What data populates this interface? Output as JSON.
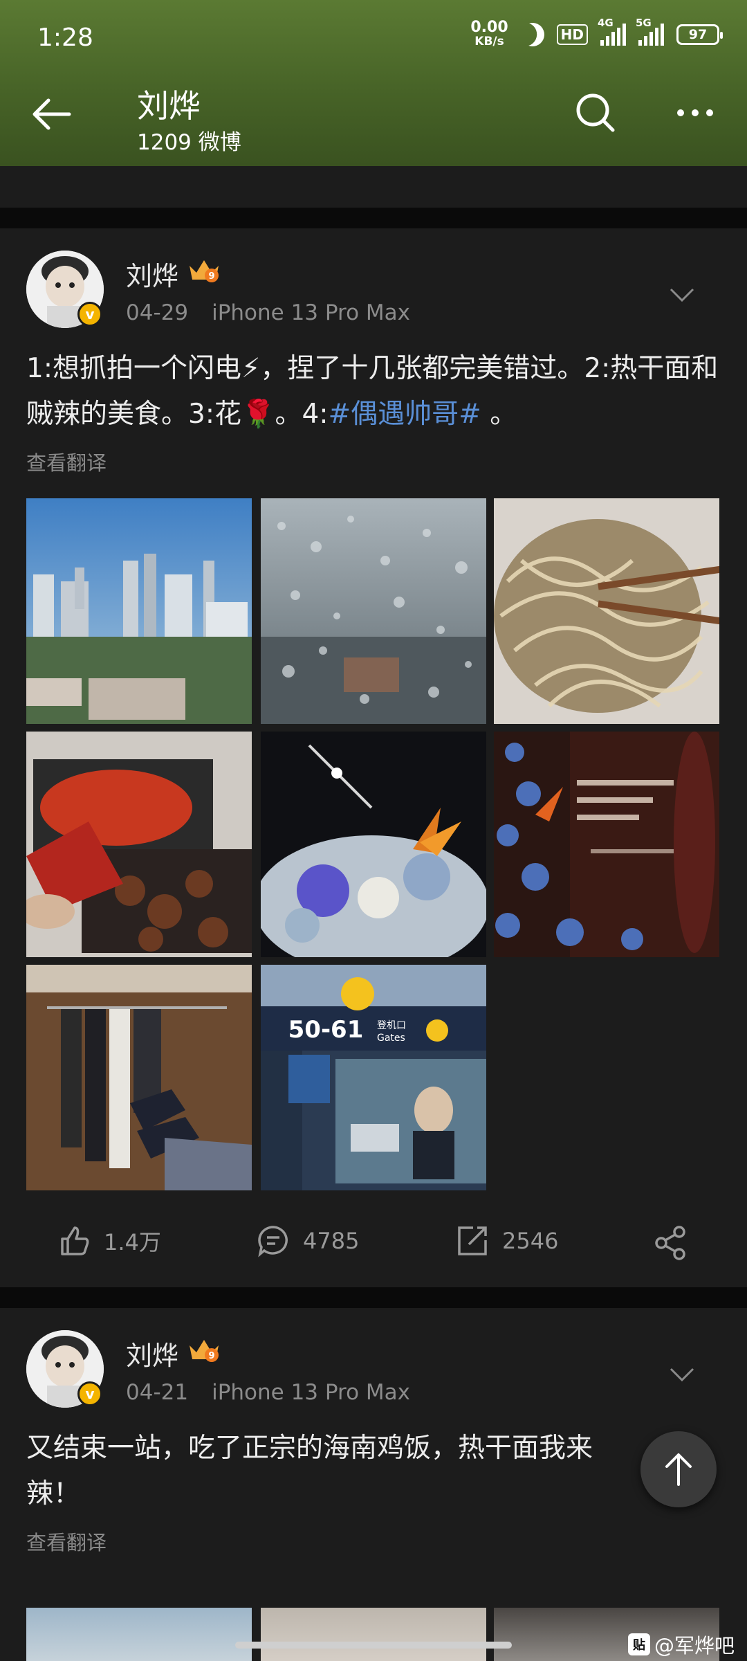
{
  "status_bar": {
    "time": "1:28",
    "speed_value": "0.00",
    "speed_unit": "KB/s",
    "hd_label": "HD",
    "net1": "4G",
    "net2": "5G",
    "battery": "97"
  },
  "header": {
    "name": "刘烨",
    "subtitle": "1209 微博"
  },
  "posts": [
    {
      "author": "刘烨",
      "date": "04-29",
      "device": "iPhone 13 Pro Max",
      "text_parts": {
        "a": "1:想抓拍一个闪电⚡，捏了十几张都完美错过。2:热干面和贼辣的美食。3:花🌹。4:",
        "topic": "#偶遇帅哥#",
        "b": " 。"
      },
      "translate": "查看翻译",
      "photos": [
        "city-skyline-photo",
        "raindrops-window-photo",
        "hot-dry-noodles-photo",
        "crayfish-food-photo",
        "flower-bouquet-night-photo",
        "poster-flowers-photo",
        "clothes-rack-shoes-photo",
        "airport-gate-ad-photo"
      ],
      "airport_gate_text": "50-61",
      "airport_gate_cn": "登机口",
      "airport_gate_en": "Gates",
      "likes": "1.4万",
      "comments": "4785",
      "reposts": "2546"
    },
    {
      "author": "刘烨",
      "date": "04-21",
      "device": "iPhone 13 Pro Max",
      "text_line1": "又结束一站，吃了正宗的海南鸡饭，热干面我来",
      "text_line2": "辣！",
      "translate": "查看翻译"
    }
  ],
  "verified_badge": "v",
  "level_badge": "9",
  "watermark": {
    "logo": "贴",
    "text": "@军烨吧"
  },
  "colors": {
    "header_green": "#4a6628",
    "topic_blue": "#5a8fd6",
    "background": "#131313",
    "card": "#1c1c1c"
  }
}
